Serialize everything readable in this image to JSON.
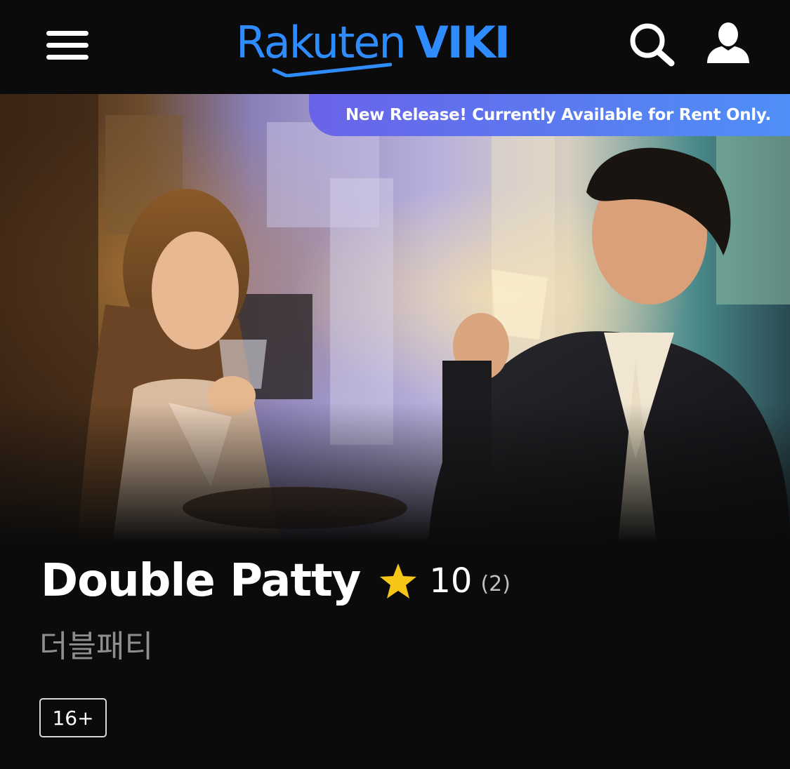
{
  "header": {
    "logo_word_1": "Rakuten",
    "logo_word_2": "VIKI",
    "menu_icon": "hamburger-menu-icon",
    "search_icon": "search-icon",
    "user_icon": "user-profile-icon",
    "brand_color": "#2f8cff"
  },
  "hero": {
    "banner_text": "New Release! Currently Available for Rent Only.",
    "banner_color": "#5a7bf0"
  },
  "show": {
    "title": "Double Patty",
    "rating": "10",
    "rating_count": "(2)",
    "native_title": "더블패티",
    "age_rating": "16+",
    "star_icon": "star-icon",
    "star_color": "#f5c518"
  }
}
